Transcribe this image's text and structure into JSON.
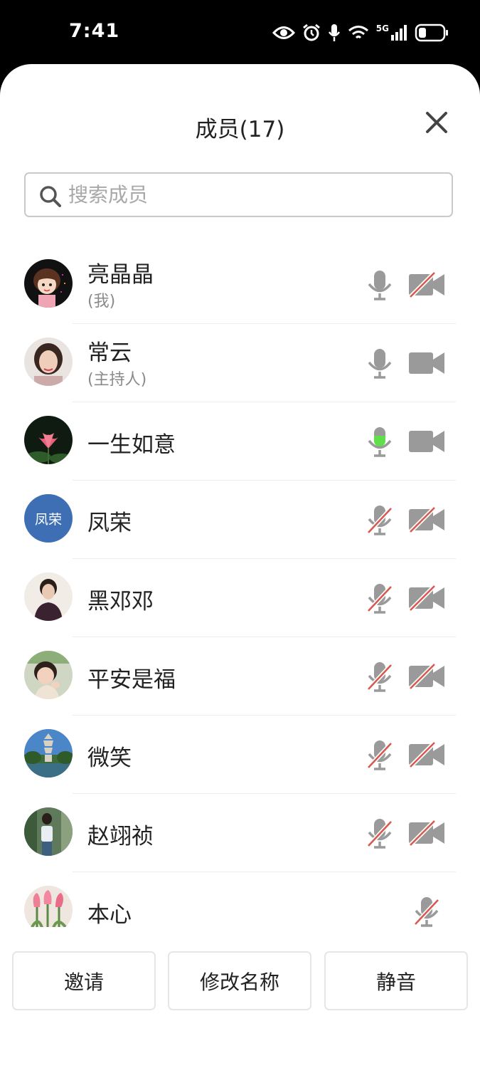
{
  "status_bar": {
    "time": "7:41",
    "network": "5G",
    "icons": [
      "eye-icon",
      "alarm-icon",
      "mic-icon",
      "wifi-icon",
      "signal-icon",
      "battery-icon"
    ]
  },
  "sheet": {
    "title": "成员(17)",
    "close_icon": "close-icon"
  },
  "search": {
    "placeholder": "搜索成员",
    "value": ""
  },
  "members": [
    {
      "name": "亮晶晶",
      "role": "(我)",
      "mic": "on",
      "camera": "off"
    },
    {
      "name": "常云",
      "role": "(主持人)",
      "mic": "on",
      "camera": "on"
    },
    {
      "name": "一生如意",
      "role": "",
      "mic": "speaking",
      "camera": "on"
    },
    {
      "name": "凤荣",
      "role": "",
      "avatar_text": "凤荣",
      "mic": "muted",
      "camera": "off"
    },
    {
      "name": "黑邓邓",
      "role": "",
      "mic": "muted",
      "camera": "off"
    },
    {
      "name": "平安是福",
      "role": "",
      "mic": "muted",
      "camera": "off"
    },
    {
      "name": "微笑",
      "role": "",
      "mic": "muted",
      "camera": "off"
    },
    {
      "name": "赵翊祯",
      "role": "",
      "mic": "muted",
      "camera": "off"
    },
    {
      "name": "本心",
      "role": "",
      "mic": "muted",
      "camera": "none"
    }
  ],
  "footer": {
    "invite": "邀请",
    "rename": "修改名称",
    "mute": "静音"
  },
  "colors": {
    "icon_gray": "#9a9a9a",
    "muted_slash": "#d9584e",
    "speaking_green": "#5fe04a",
    "avatar_blue": "#3e6fb5"
  }
}
